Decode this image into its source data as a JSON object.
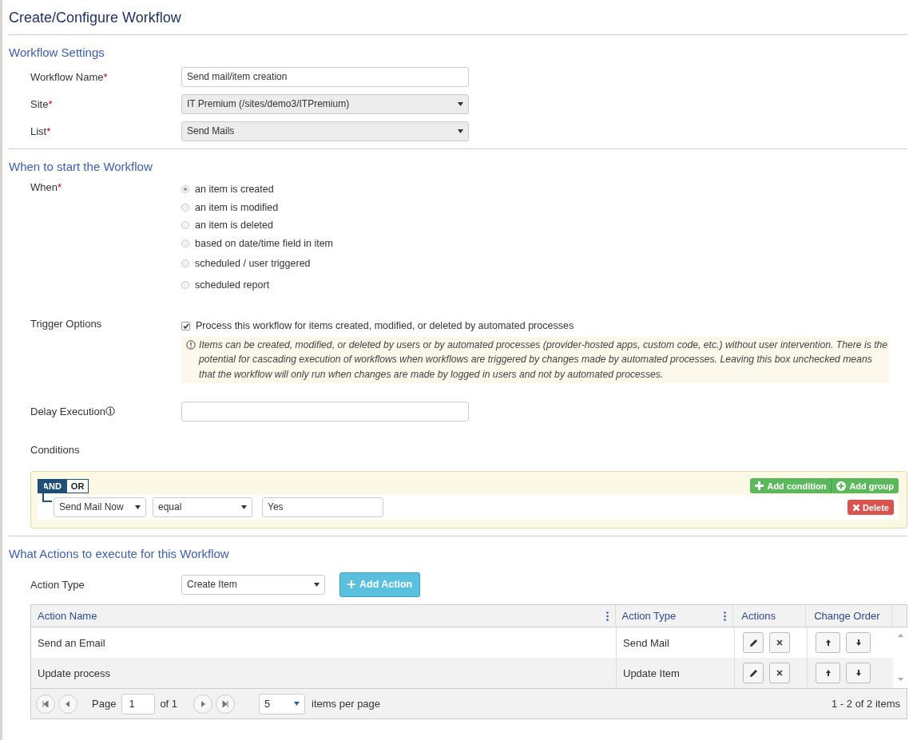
{
  "page_title": "Create/Configure Workflow",
  "settings": {
    "heading": "Workflow Settings",
    "fields": [
      {
        "label": "Workflow Name",
        "required_mark": "*",
        "kind": "text",
        "value": "Send mail/item creation"
      },
      {
        "label": "Site",
        "required_mark": "*",
        "kind": "select",
        "value": "IT Premium (/sites/demo3/ITPremium)"
      },
      {
        "label": "List",
        "required_mark": "*",
        "kind": "select",
        "value": "Send Mails"
      }
    ]
  },
  "start": {
    "heading": "When to start the Workflow",
    "when": {
      "label": "When",
      "required_mark": "*",
      "options": [
        {
          "label": "an item is created",
          "selected": true
        },
        {
          "label": "an item is modified",
          "selected": false
        },
        {
          "label": "an item is deleted",
          "selected": false
        },
        {
          "label": "based on date/time field in item",
          "selected": false
        },
        {
          "label": "scheduled / user triggered",
          "selected": false
        },
        {
          "label": "scheduled report",
          "selected": false
        }
      ]
    },
    "trigger": {
      "label": "Trigger Options",
      "option": {
        "label": "Process this workflow for items created, modified, or deleted by automated processes",
        "checked": true
      },
      "note": "Items can be created, modified, or deleted by users or by automated processes (provider-hosted apps, custom code, etc.) without user intervention. There is the potential for cascading execution of workflows when workflows are triggered by changes made by automated processes. Leaving this box unchecked means that the workflow will only run when changes are made by logged in users and not by automated processes."
    },
    "delay": {
      "label": "Delay Execution"
    },
    "conditions": {
      "label": "Conditions",
      "logic": [
        {
          "label": "AND",
          "selected": true
        },
        {
          "label": "OR",
          "selected": false
        }
      ],
      "buttons": [
        {
          "label": "Add condition",
          "kind": "plus"
        },
        {
          "label": "Add group",
          "kind": "plus-circle"
        }
      ],
      "rows": [
        {
          "field": "Send Mail Now",
          "operator": "equal",
          "value": "Yes",
          "delete": "Delete"
        }
      ]
    }
  },
  "actions": {
    "heading": "What Actions to execute for this Workflow",
    "action_type": {
      "label": "Action Type",
      "value": "Create Item",
      "add_button": "Add Action"
    },
    "table": {
      "columns": [
        "Action Name",
        "Action Type",
        "Actions",
        "Change Order"
      ],
      "rows": [
        {
          "name": "Send an Email",
          "type": "Send Mail"
        },
        {
          "name": "Update process",
          "type": "Update Item"
        }
      ]
    },
    "pager": {
      "page_label": "Page",
      "page": "1",
      "of": "of 1",
      "page_size": "5",
      "per_page": "items per page",
      "summary": "1 - 2 of 2 items"
    }
  }
}
